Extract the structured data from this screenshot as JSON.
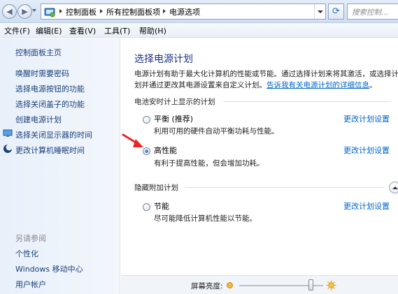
{
  "address": {
    "crumbs": [
      "控制面板",
      "所有控制面板项",
      "电源选项"
    ],
    "search_placeholder": "搜索控制..."
  },
  "menu": [
    "文件(F)",
    "编辑(E)",
    "查看(V)",
    "工具(T)",
    "帮助(H)"
  ],
  "sidebar": {
    "home": "控制面板主页",
    "links": [
      "唤醒时需要密码",
      "选择电源按钮的功能",
      "选择关闭盖子的功能",
      "创建电源计划"
    ],
    "icon_links": [
      "选择关闭显示器的时间",
      "更改计算机睡眠时间"
    ],
    "see_also_title": "另请参阅",
    "see_also": [
      "个性化",
      "Windows 移动中心",
      "用户帐户"
    ]
  },
  "main": {
    "title": "选择电源计划",
    "description": "电源计划有助于最大化计算机的性能或节能。通过选择计划来将其激活，或选择计划并通过更改其电源设置来自定义计划。",
    "description_link": "告诉我有关电源计划的详细信息",
    "battery_group": "电池安时计上显示的计划",
    "hidden_group": "隐藏附加计划",
    "plans": [
      {
        "name": "平衡 (推荐)",
        "desc": "利用可用的硬件自动平衡功耗与性能。",
        "selected": false,
        "link": "更改计划设置"
      },
      {
        "name": "高性能",
        "desc": "有利于提高性能，但会增加功耗。",
        "selected": true,
        "link": "更改计划设置"
      },
      {
        "name": "节能",
        "desc": "尽可能降低计算机性能以节能。",
        "selected": false,
        "link": "更改计划设置"
      }
    ],
    "brightness_label": "屏幕亮度:",
    "brightness_level": 0.85
  },
  "colors": {
    "link": "#0066cc",
    "title": "#1e3287",
    "annotation_arrow": "#e8262a"
  }
}
